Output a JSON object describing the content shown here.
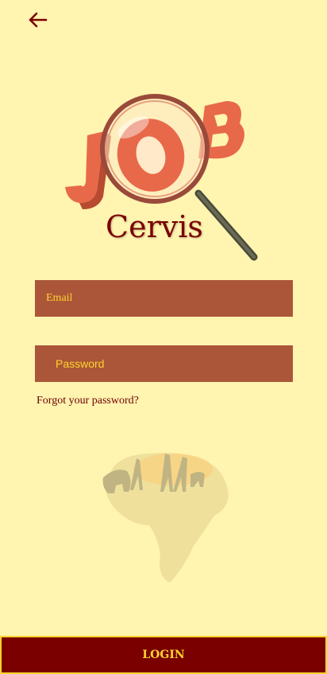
{
  "header": {
    "back_icon": "arrow-left-icon"
  },
  "logo": {
    "letters": "JOB",
    "word": "Cervis"
  },
  "form": {
    "email_placeholder": "Email",
    "password_placeholder": "Password",
    "forgot_label": "Forgot your password?"
  },
  "footer": {
    "login_label": "LOGIN"
  },
  "colors": {
    "background": "#FFF4B0",
    "field": "#AB5638",
    "accent": "#FFD32E",
    "primary": "#7a0000"
  }
}
